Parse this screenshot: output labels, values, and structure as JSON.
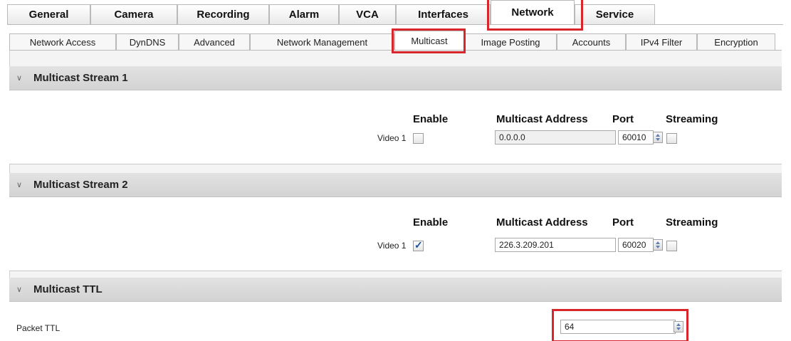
{
  "main_tabs": [
    {
      "label": "General"
    },
    {
      "label": "Camera"
    },
    {
      "label": "Recording"
    },
    {
      "label": "Alarm"
    },
    {
      "label": "VCA"
    },
    {
      "label": "Interfaces"
    },
    {
      "label": "Network",
      "active": true
    },
    {
      "label": "Service"
    }
  ],
  "sub_tabs": [
    {
      "label": "Network Access"
    },
    {
      "label": "DynDNS"
    },
    {
      "label": "Advanced"
    },
    {
      "label": "Network Management"
    },
    {
      "label": "Multicast",
      "active": true
    },
    {
      "label": "Image Posting"
    },
    {
      "label": "Accounts"
    },
    {
      "label": "IPv4 Filter"
    },
    {
      "label": "Encryption"
    }
  ],
  "columns": {
    "enable": "Enable",
    "address": "Multicast Address",
    "port": "Port",
    "streaming": "Streaming"
  },
  "stream1": {
    "title": "Multicast Stream 1",
    "row_label": "Video 1",
    "enabled": false,
    "address": "0.0.0.0",
    "port": "60010",
    "streaming": false
  },
  "stream2": {
    "title": "Multicast Stream 2",
    "row_label": "Video 1",
    "enabled": true,
    "address": "226.3.209.201",
    "port": "60020",
    "streaming": false
  },
  "ttl": {
    "title": "Multicast TTL",
    "label": "Packet TTL",
    "value": "64"
  },
  "highlight_color": "#d9262c"
}
